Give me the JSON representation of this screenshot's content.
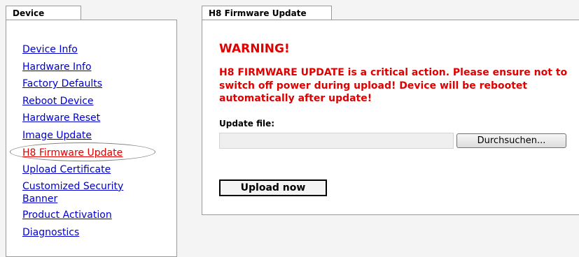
{
  "left_tab": {
    "label": "Device"
  },
  "nav": {
    "items": [
      {
        "label": "Device Info"
      },
      {
        "label": "Hardware Info"
      },
      {
        "label": "Factory Defaults"
      },
      {
        "label": "Reboot Device"
      },
      {
        "label": "Hardware Reset"
      },
      {
        "label": "Image Update"
      },
      {
        "label": "H8 Firmware Update",
        "active": true
      },
      {
        "label": "Upload Certificate"
      },
      {
        "label": "Customized Security Banner"
      },
      {
        "label": "Product Activation"
      },
      {
        "label": "Diagnostics"
      }
    ]
  },
  "right_tab": {
    "label": "H8 Firmware Update"
  },
  "main": {
    "warning_title": "WARNING!",
    "warning_text": "H8 FIRMWARE UPDATE is a critical action. Please ensure not to switch off power during upload! Device will be rebootet automatically after update!",
    "file_label": "Update file:",
    "file_value": "",
    "browse_label": "Durchsuchen...",
    "upload_label": "Upload now"
  },
  "colors": {
    "warning": "#e00000",
    "link": "#0000cc",
    "active_link": "#e00000"
  }
}
